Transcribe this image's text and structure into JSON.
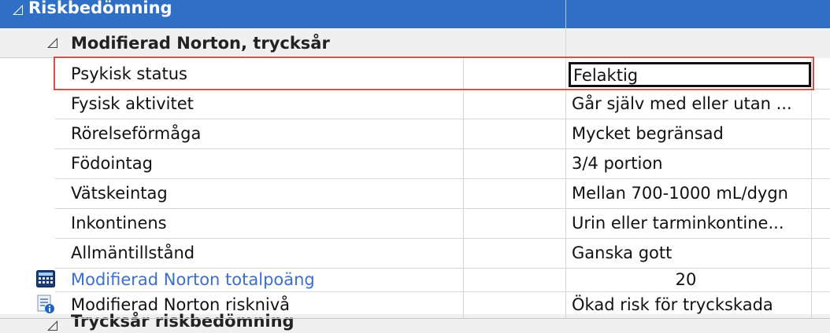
{
  "section": {
    "title": "Riskbedömning",
    "expand_glyph": "◿"
  },
  "subsection": {
    "title": "Modifierad Norton, trycksår",
    "expand_glyph": "◿"
  },
  "rows": [
    {
      "label": "Psykisk status",
      "value": "Felaktig",
      "selected": true
    },
    {
      "label": "Fysisk aktivitet",
      "value": "Går själv med eller utan ..."
    },
    {
      "label": "Rörelseförmåga",
      "value": "Mycket begränsad"
    },
    {
      "label": "Födointag",
      "value": "3/4 portion"
    },
    {
      "label": "Vätskeintag",
      "value": "Mellan 700-1000 mL/dygn"
    },
    {
      "label": "Inkontinens",
      "value": "Urin eller tarminkontine..."
    },
    {
      "label": "Allmäntillstånd",
      "value": "Ganska gott"
    }
  ],
  "total": {
    "label": "Modifierad Norton totalpoäng",
    "value": "20",
    "icon": "calculator-icon"
  },
  "risk": {
    "label": "Modifierad Norton risknivå",
    "value": "Ökad risk för tryckskada",
    "icon": "document-info-icon"
  },
  "next_section": {
    "title": "Trycksår riskbedömning",
    "expand_glyph": "◿"
  },
  "colors": {
    "header_blue": "#2f6fc6",
    "highlight_red": "#e24a4a",
    "link_blue": "#3a6fd0"
  }
}
